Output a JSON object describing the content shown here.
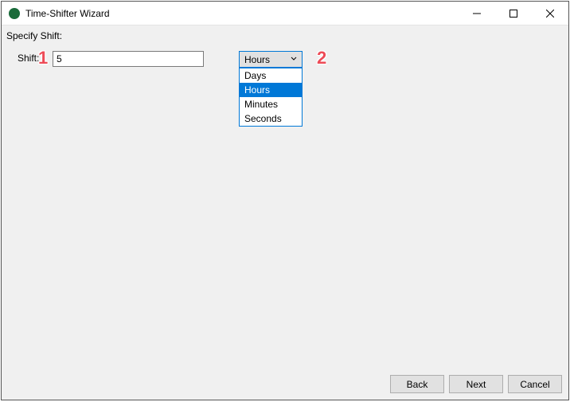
{
  "window": {
    "title": "Time-Shifter Wizard"
  },
  "section": {
    "label": "Specify Shift:"
  },
  "shift": {
    "label": "Shift:",
    "value": "5",
    "unit_selected": "Hours",
    "unit_options": [
      "Days",
      "Hours",
      "Minutes",
      "Seconds"
    ]
  },
  "annotations": {
    "one": "1",
    "two": "2"
  },
  "buttons": {
    "back": "Back",
    "next": "Next",
    "cancel": "Cancel"
  }
}
